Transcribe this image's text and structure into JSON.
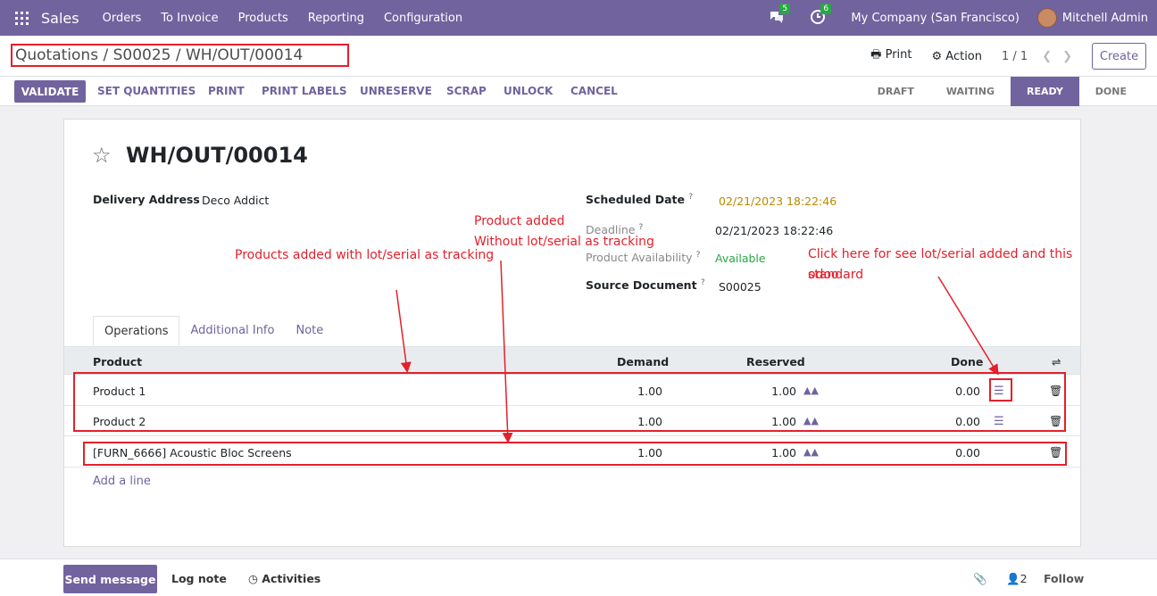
{
  "nav": {
    "brand": "Sales",
    "menus": [
      "Orders",
      "To Invoice",
      "Products",
      "Reporting",
      "Configuration"
    ],
    "chat_count": "5",
    "activity_count": "6",
    "company": "My Company (San Francisco)",
    "user": "Mitchell Admin"
  },
  "control": {
    "breadcrumb": "Quotations / S00025 / WH/OUT/00014",
    "print": "Print",
    "action": "Action",
    "pager": "1 / 1",
    "create": "Create"
  },
  "buttons": {
    "validate": "VALIDATE",
    "set_quantities": "SET QUANTITIES",
    "print": "PRINT",
    "print_labels": "PRINT LABELS",
    "unreserve": "UNRESERVE",
    "scrap": "SCRAP",
    "unlock": "UNLOCK",
    "cancel": "CANCEL"
  },
  "statusbar": [
    "DRAFT",
    "WAITING",
    "READY",
    "DONE"
  ],
  "statusbar_current": "READY",
  "form": {
    "name": "WH/OUT/00014",
    "delivery_address_label": "Delivery Address",
    "delivery_address": "Deco Addict",
    "scheduled_date_label": "Scheduled Date",
    "scheduled_date": "02/21/2023 18:22:46",
    "deadline_label": "Deadline",
    "deadline": "02/21/2023 18:22:46",
    "availability_label": "Product Availability",
    "availability": "Available",
    "source_label": "Source Document",
    "source": "S00025",
    "help": "?"
  },
  "annotations": {
    "lot_tracking": "Products added with lot/serial as tracking",
    "no_lot_line1": "Product added",
    "no_lot_line2": "Without lot/serial as tracking",
    "click_line1": "Click here for see lot/serial added and this odoo",
    "click_line2": "standard"
  },
  "tabs": [
    "Operations",
    "Additional Info",
    "Note"
  ],
  "table": {
    "headers": {
      "product": "Product",
      "demand": "Demand",
      "reserved": "Reserved",
      "done": "Done"
    },
    "rows": [
      {
        "product": "Product 1",
        "demand": "1.00",
        "reserved": "1.00",
        "done": "0.00"
      },
      {
        "product": "Product 2",
        "demand": "1.00",
        "reserved": "1.00",
        "done": "0.00"
      },
      {
        "product": "[FURN_6666] Acoustic Bloc Screens",
        "demand": "1.00",
        "reserved": "1.00",
        "done": "0.00"
      }
    ],
    "add_line": "Add a line"
  },
  "chatter": {
    "send": "Send message",
    "log": "Log note",
    "activities": "Activities",
    "followers": "2",
    "follow": "Follow"
  },
  "colors": {
    "primary": "#71639e",
    "annotation": "#e3202c",
    "available": "#28a745",
    "scheduled": "#b98a00"
  }
}
